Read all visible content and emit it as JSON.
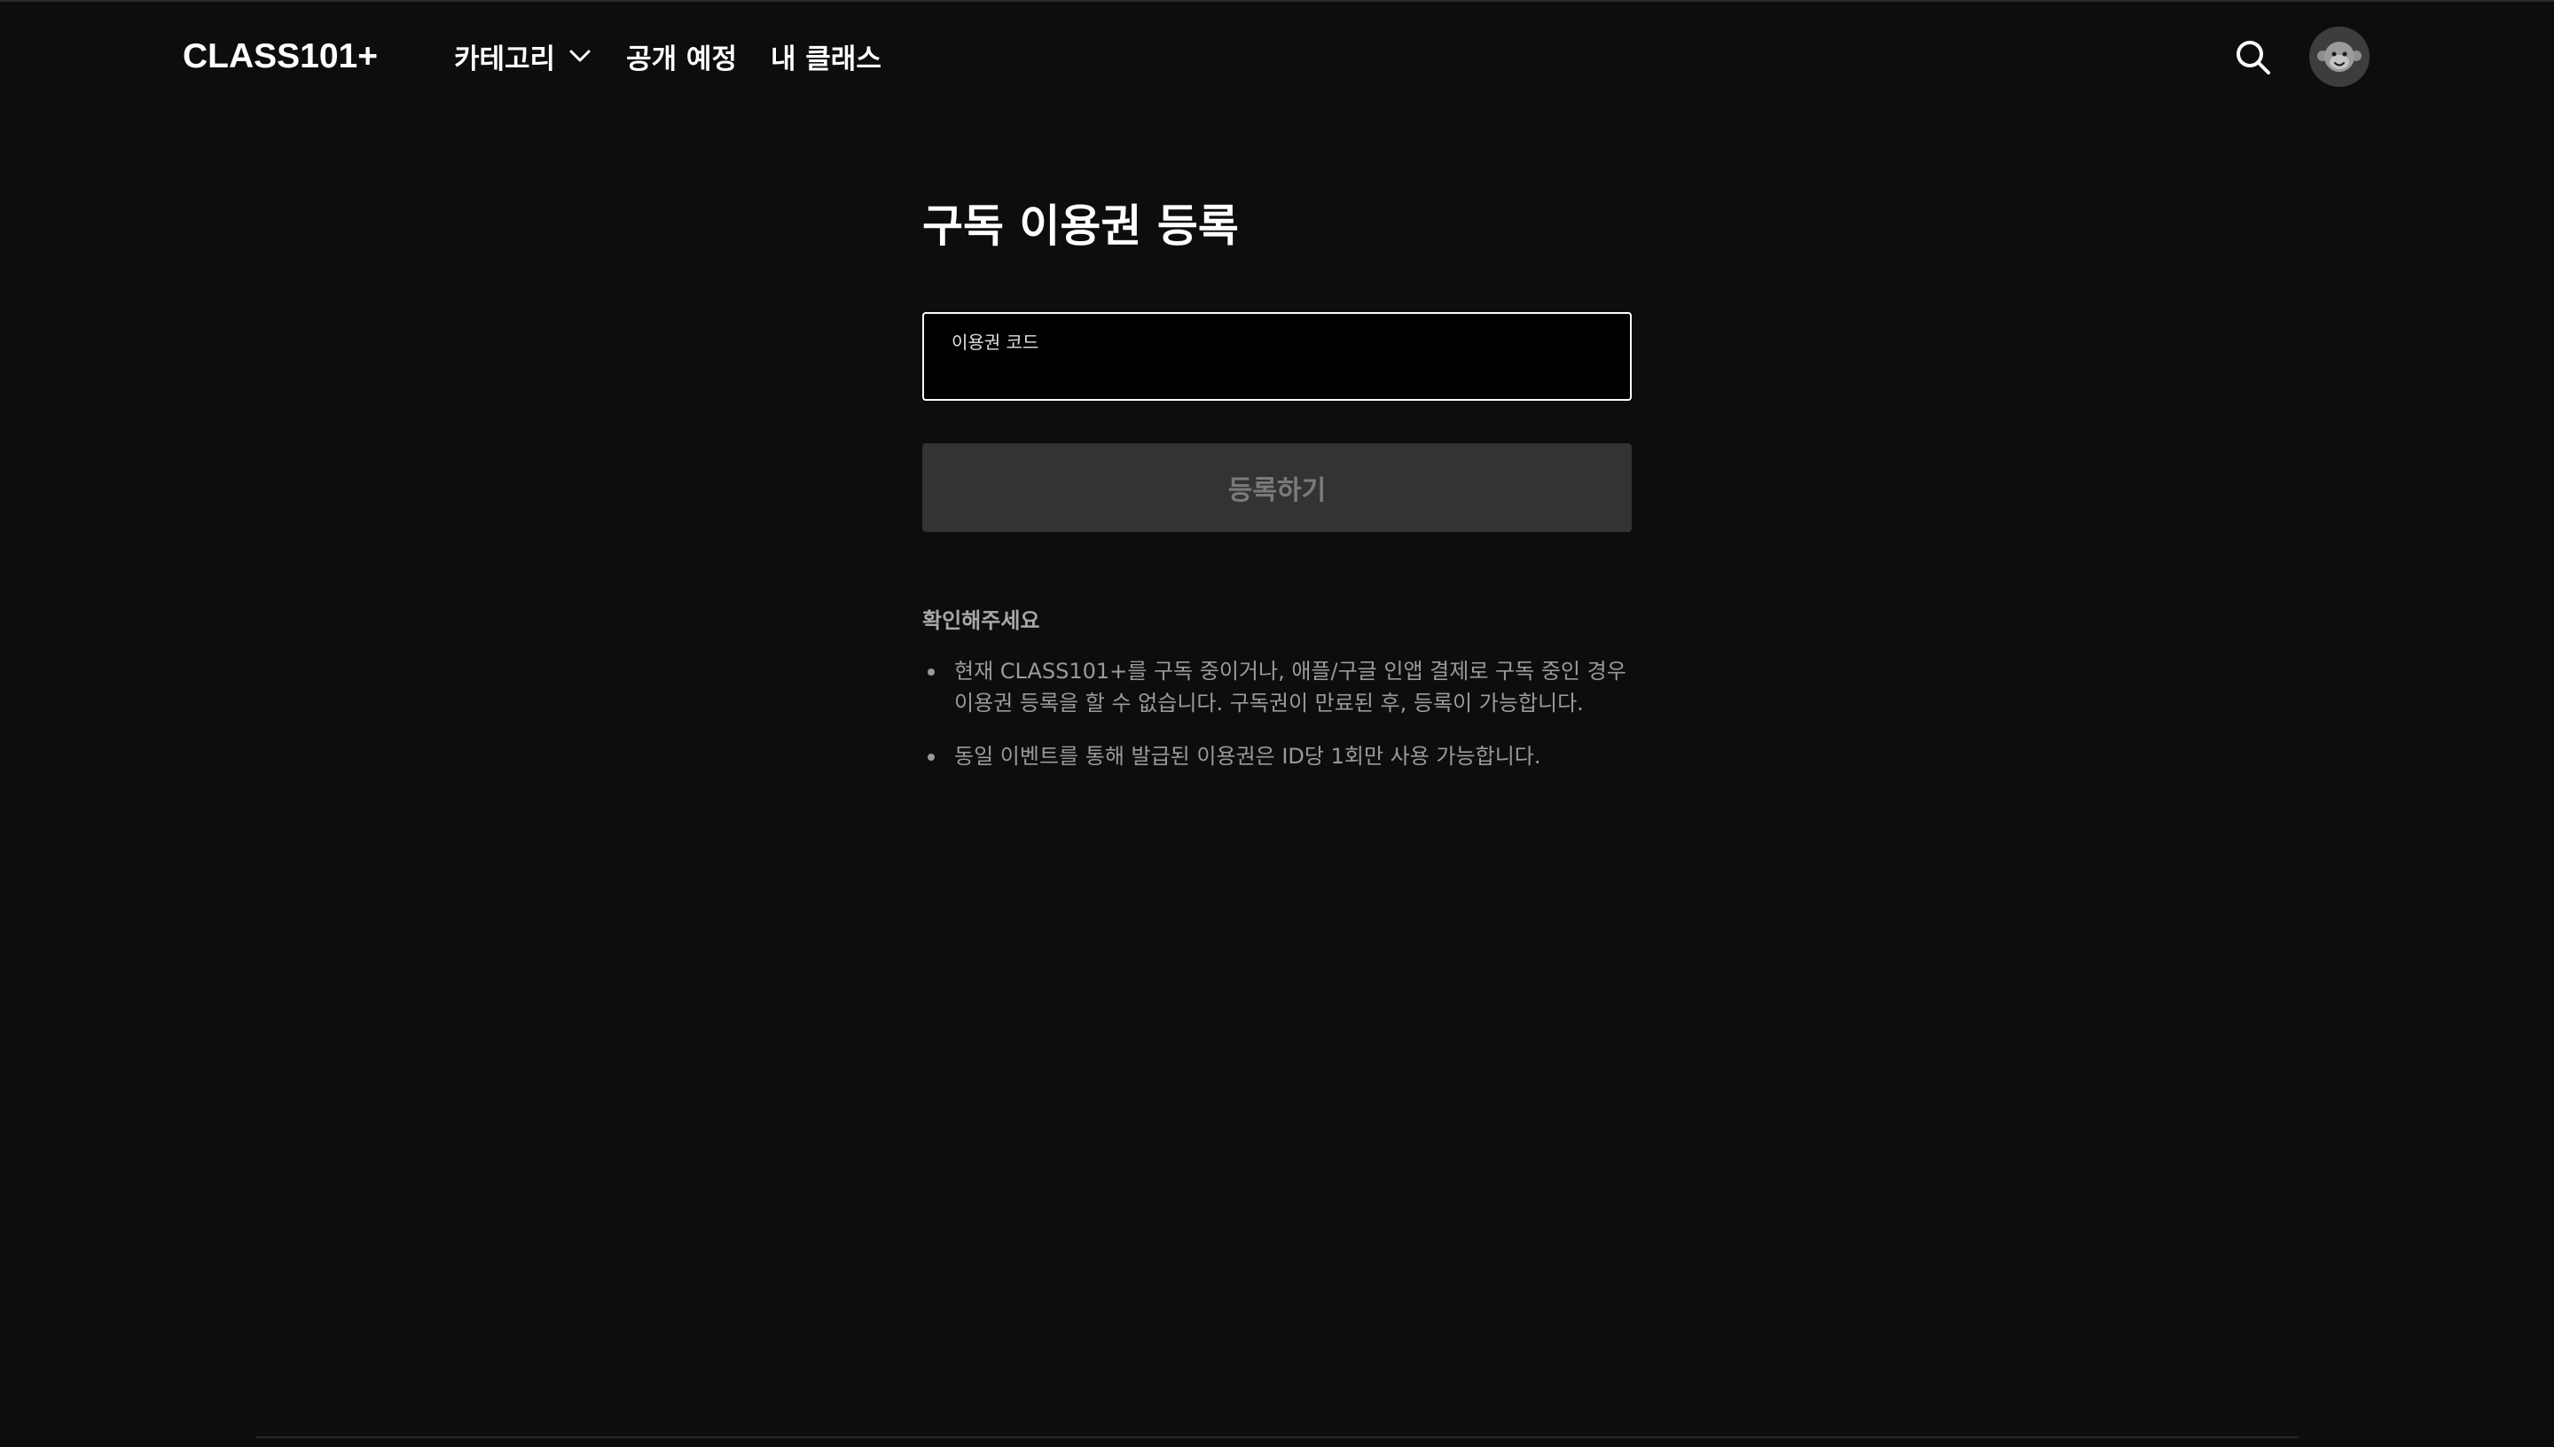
{
  "header": {
    "logo": "CLASS101+",
    "nav": [
      {
        "label": "카테고리",
        "has_dropdown": true
      },
      {
        "label": "공개 예정"
      },
      {
        "label": "내 클래스"
      }
    ],
    "search_icon": "search-icon",
    "avatar_icon": "monkey-avatar-icon"
  },
  "main": {
    "title": "구독 이용권 등록",
    "code_field": {
      "label": "이용권 코드",
      "value": "",
      "placeholder": ""
    },
    "submit_label": "등록하기",
    "notice": {
      "title": "확인해주세요",
      "items": [
        "현재 CLASS101+를 구독 중이거나, 애플/구글 인앱 결제로 구독 중인 경우 이용권 등록을 할 수 없습니다. 구독권이 만료된 후, 등록이 가능합니다.",
        "동일 이벤트를 통해 발급된 이용권은 ID당 1회만 사용 가능합니다."
      ]
    }
  },
  "colors": {
    "background": "#0d0d0d",
    "button_disabled_bg": "#333333",
    "button_disabled_text": "#7a7a7a",
    "notice_text": "#9a9a9a"
  }
}
